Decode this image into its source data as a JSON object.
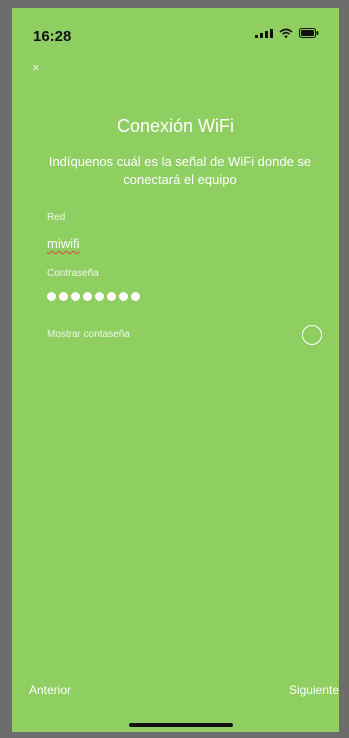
{
  "status_bar": {
    "time": "16:28",
    "icons": [
      "signal-icon",
      "wifi-icon",
      "battery-icon"
    ]
  },
  "header": {
    "close_glyph": "×"
  },
  "main": {
    "title": "Conexión WiFi",
    "subtitle": "Indíquenos cuál es la señal de WiFi donde se conectará el equipo",
    "network_label": "Red",
    "network_value": "miwifi",
    "password_label": "Contraseña",
    "password_length": 8,
    "show_password_label": "Mostrar contaseña"
  },
  "footer": {
    "prev_label": "Anterior",
    "next_label": "Siguiente"
  },
  "colors": {
    "background": "#8fcf61",
    "text": "#ffffff",
    "frame": "#6d6d6d"
  }
}
